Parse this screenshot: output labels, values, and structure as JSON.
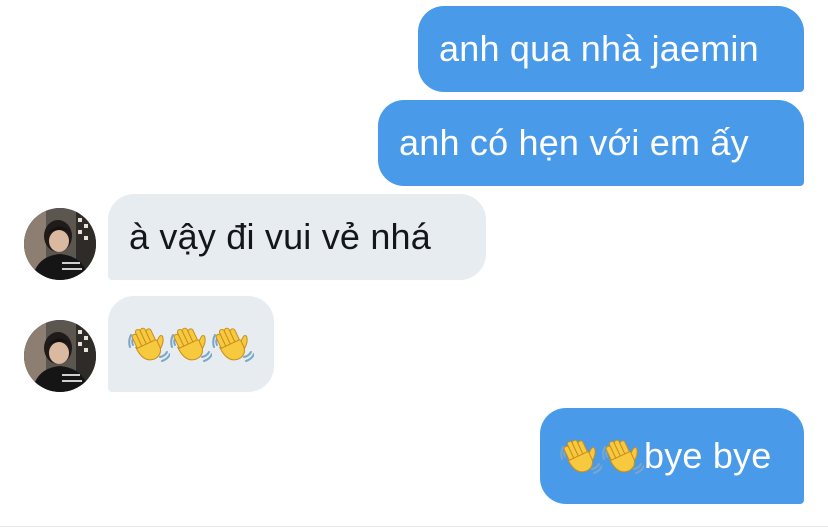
{
  "messages": [
    {
      "id": "m1",
      "direction": "outgoing",
      "text": "anh qua nhà jaemin"
    },
    {
      "id": "m2",
      "direction": "outgoing",
      "text": "anh có hẹn với em ấy"
    },
    {
      "id": "m3",
      "direction": "incoming",
      "text": "à vậy đi vui vẻ nhá"
    },
    {
      "id": "m4",
      "direction": "incoming",
      "emoji": [
        "waving-hand-icon",
        "waving-hand-icon",
        "waving-hand-icon"
      ]
    },
    {
      "id": "m5",
      "direction": "outgoing",
      "emoji": [
        "waving-hand-icon",
        "waving-hand-icon"
      ],
      "text": "bye bye"
    }
  ],
  "colors": {
    "outgoing_bubble": "#4a9aea",
    "incoming_bubble": "#e6ecf0",
    "outgoing_text": "#ffffff",
    "incoming_text": "#14171a"
  }
}
